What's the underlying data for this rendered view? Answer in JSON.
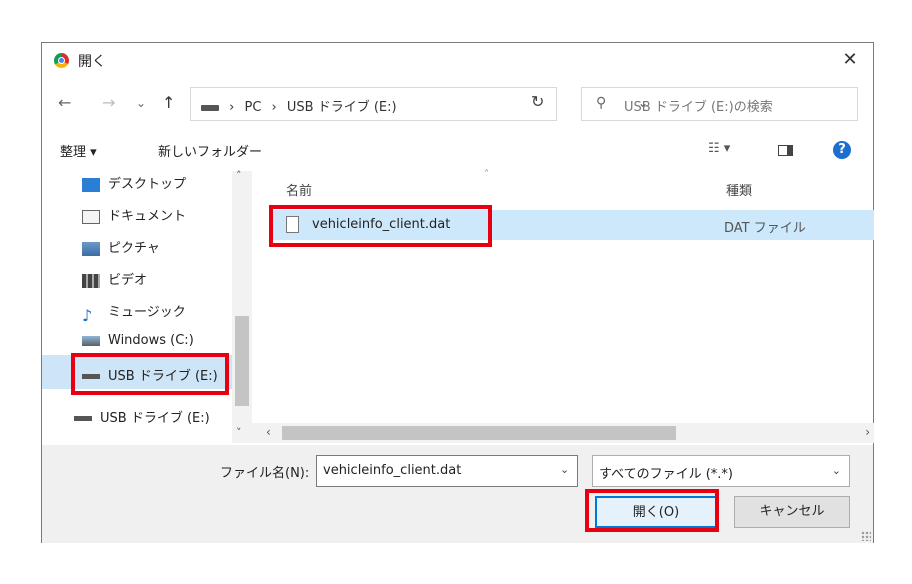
{
  "window": {
    "title": "開く",
    "close_glyph": "✕"
  },
  "nav": {
    "back": "←",
    "forward": "→",
    "recent": "⌄",
    "up": "↑",
    "breadcrumb": [
      "PC",
      "USB ドライブ (E:)"
    ],
    "crumb_sep": "›",
    "dropdown": "⌄",
    "refresh": "↻",
    "search_placeholder": "USB ドライブ (E:)の検索"
  },
  "toolbar": {
    "organize": "整理 ▾",
    "new_folder": "新しいフォルダー",
    "view_icon": "☷ ▾",
    "help": "?"
  },
  "sidebar": {
    "items": [
      {
        "label": "デスクトップ",
        "icon": "desktop-icon"
      },
      {
        "label": "ドキュメント",
        "icon": "document-icon"
      },
      {
        "label": "ピクチャ",
        "icon": "pictures-icon"
      },
      {
        "label": "ビデオ",
        "icon": "video-icon"
      },
      {
        "label": "ミュージック",
        "icon": "music-icon"
      },
      {
        "label": "Windows (C:)",
        "icon": "windows-drive-icon"
      },
      {
        "label": "USB ドライブ (E:)",
        "icon": "usb-drive-icon"
      },
      {
        "label": "USB ドライブ (E:)",
        "icon": "usb-drive-icon"
      }
    ]
  },
  "columns": {
    "name": "名前",
    "type": "種類"
  },
  "files": [
    {
      "name": "vehicleinfo_client.dat",
      "type": "DAT ファイル"
    }
  ],
  "footer": {
    "filename_label": "ファイル名(N):",
    "filename_value": "vehicleinfo_client.dat",
    "filetype_value": "すべてのファイル (*.*)",
    "open_button": "開く(O)",
    "cancel_button": "キャンセル"
  },
  "colors": {
    "highlight_frame": "#e60012",
    "selection": "#cde8fb",
    "accent": "#0078d7"
  }
}
